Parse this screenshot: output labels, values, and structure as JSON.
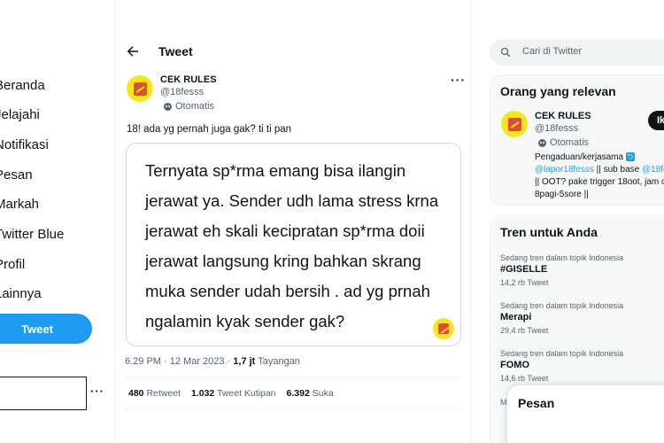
{
  "sidebar": {
    "items": [
      {
        "label": "Beranda"
      },
      {
        "label": "Jelajahi"
      },
      {
        "label": "Notifikasi"
      },
      {
        "label": "Pesan"
      },
      {
        "label": "Markah"
      },
      {
        "label": "Twitter Blue"
      },
      {
        "label": "Profil"
      },
      {
        "label": "Lainnya"
      }
    ],
    "tweet_button": "Tweet",
    "account_more": "···"
  },
  "header": {
    "title": "Tweet"
  },
  "tweet": {
    "author_name": "CEK RULES",
    "author_handle": "@18fesss",
    "automated_label": "Otomatis",
    "more": "···",
    "text": "18! ada yg pernah juga gak? ti ti pan",
    "media_text": "Ternyata sp*rma emang bisa ilangin jerawat ya. Sender udh lama stress krna jerawat eh skali kecipratan sp*rma doii jerawat langsung kring bahkan skrang muka sender udah bersih . ad yg prnah ngalamin kyak sender gak?",
    "timestamp": "6.29 PM · 12 Mar 2023 · ",
    "views": "1,7 jt",
    "views_label": " Tayangan",
    "stats": {
      "retweets": "480",
      "retweets_label": " Retweet",
      "quotes": "1.032",
      "quotes_label": " Tweet Kutipan",
      "likes": "6.392",
      "likes_label": " Suka"
    }
  },
  "search": {
    "placeholder": "Cari di Twitter"
  },
  "relevant": {
    "title": "Orang yang relevan",
    "name": "CEK RULES",
    "handle": "@18fesss",
    "automated_label": "Otomatis",
    "follow_label": "Ik",
    "bio_line1": "Pengaduan/kerjasama",
    "bio_link1": "@lapor18fesss",
    "bio_mid": " || sub base ",
    "bio_link2": "@18fe",
    "bio_line3": "|| OOT? pake trigger 18oot, jam o",
    "bio_line4": "8pagi-5sore ||"
  },
  "trends": {
    "title": "Tren untuk Anda",
    "items": [
      {
        "context": "Sedang tren dalam topik Indonesia",
        "name": "#GISELLE",
        "count": "14,2 rb Tweet"
      },
      {
        "context": "Sedang tren dalam topik Indonesia",
        "name": "Merapi",
        "count": "29,4 rb Tweet"
      },
      {
        "context": "Sedang tren dalam topik Indonesia",
        "name": "FOMO",
        "count": "14,6 rb Tweet"
      }
    ],
    "partial_next": "Mu"
  },
  "messages": {
    "title": "Pesan"
  },
  "colors": {
    "accent": "#1d9bf0",
    "avatar_bg": "#f5e71a",
    "avatar_fg": "#e5483c"
  }
}
